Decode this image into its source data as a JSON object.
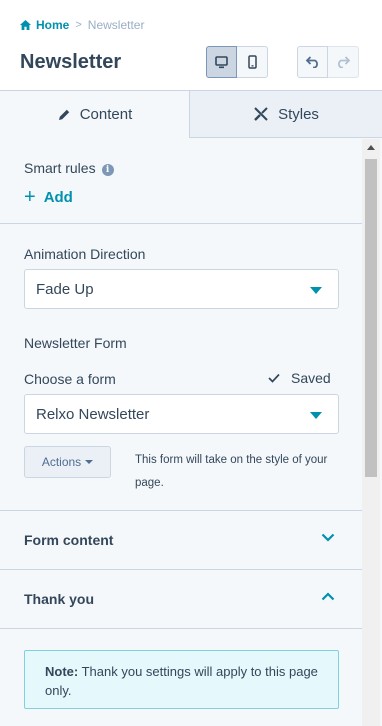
{
  "header": {
    "breadcrumb": {
      "home": "Home",
      "separator": ">",
      "current": "Newsletter"
    },
    "title": "Newsletter",
    "view_buttons": [
      "desktop-icon",
      "mobile-icon"
    ],
    "history_buttons": [
      "undo-icon",
      "redo-icon"
    ]
  },
  "tabs": [
    {
      "label": "Content",
      "icon": "pencil-icon",
      "active": true
    },
    {
      "label": "Styles",
      "icon": "brush-icon",
      "active": false
    }
  ],
  "smart_rules": {
    "label": "Smart rules",
    "info_icon": "i",
    "add_label": "Add"
  },
  "animation": {
    "label": "Animation Direction",
    "value": "Fade Up"
  },
  "newsletter_form": {
    "section_label": "Newsletter Form",
    "choose_label": "Choose a form",
    "saved_label": "Saved",
    "selected_form": "Relxo Newsletter",
    "actions_label": "Actions",
    "help_text": "This form will take on the style of your page."
  },
  "sections": [
    {
      "title": "Form content",
      "expanded": false
    },
    {
      "title": "Thank you",
      "expanded": true
    }
  ],
  "note": {
    "label": "Note:",
    "text": "Thank you settings will apply to this page only."
  },
  "colors": {
    "accent": "#0091ae",
    "text": "#33475b",
    "panel": "#f5f8fa",
    "border": "#cbd6e2"
  }
}
